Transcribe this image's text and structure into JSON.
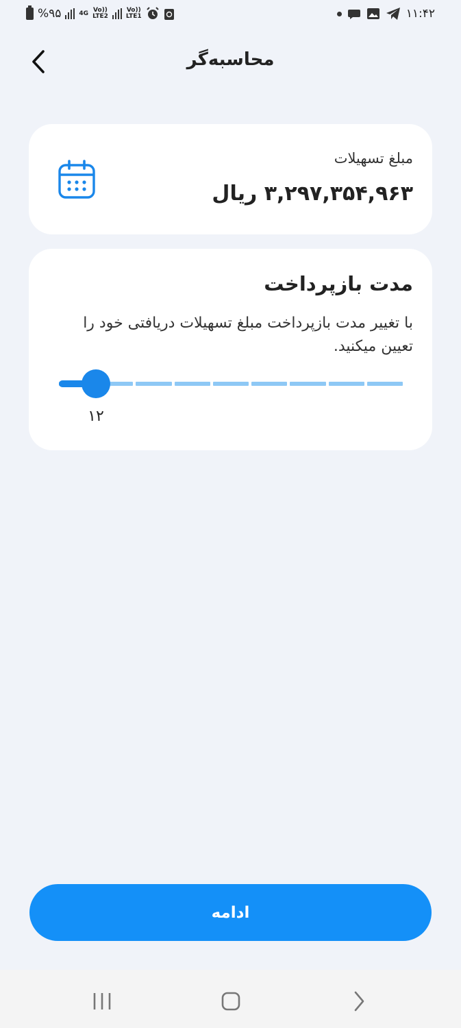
{
  "status_bar": {
    "time": "۱۱:۴۲",
    "battery": "%۹۵",
    "network_1": "4G",
    "network_2_top": "Vo))",
    "network_2_bottom": "LTE2",
    "network_3_top": "Vo))",
    "network_3_bottom": "LTE1"
  },
  "header": {
    "title": "محاسبه‌گر",
    "back_icon": "chevron-left-icon"
  },
  "amount_card": {
    "label": "مبلغ تسهیلات",
    "value": "۳,۲۹۷,۳۵۴,۹۶۳ ریال",
    "icon": "calendar-icon",
    "accent_color": "#1a87ea"
  },
  "term_card": {
    "title": "مدت بازپرداخت",
    "description": "با تغییر مدت بازپرداخت مبلغ تسهیلات دریافتی خود را تعیین میکنید.",
    "slider": {
      "value_label": "۱۲",
      "position": 0,
      "steps": 9,
      "fill_color": "#1a87ea",
      "track_color": "#8ec8f5"
    }
  },
  "continue_button": {
    "label": "ادامه",
    "color": "#1490f8"
  },
  "nav_bar": {
    "recents_icon": "recents-icon",
    "home_icon": "home-icon",
    "back_icon": "back-icon"
  }
}
